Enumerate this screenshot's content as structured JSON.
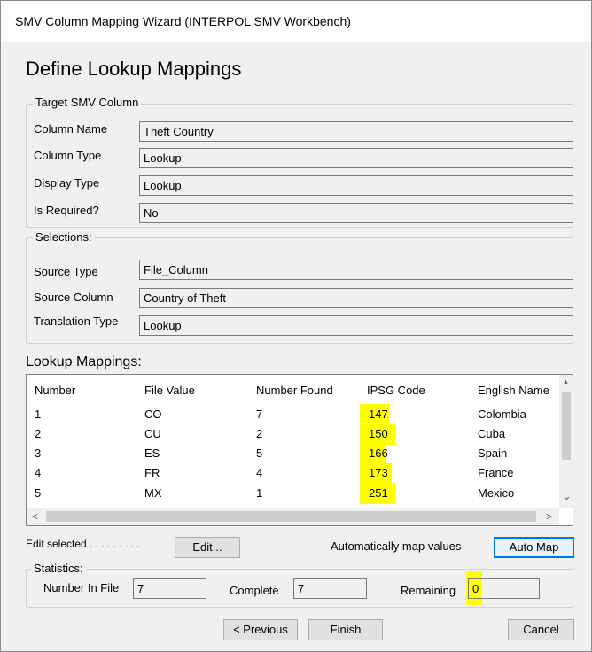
{
  "window": {
    "title": "SMV Column Mapping Wizard (INTERPOL SMV Workbench)"
  },
  "page_title": "Define Lookup Mappings",
  "target": {
    "group_label": "Target SMV Column",
    "column_name_label": "Column Name",
    "column_name": "Theft Country",
    "column_type_label": "Column Type",
    "column_type": "Lookup",
    "display_type_label": "Display Type",
    "display_type": "Lookup",
    "is_required_label": "Is Required?",
    "is_required": "No"
  },
  "selections": {
    "group_label": "Selections:",
    "source_type_label": "Source Type",
    "source_type": "File_Column",
    "source_column_label": "Source Column",
    "source_column": "Country of Theft",
    "translation_type_label": "Translation Type",
    "translation_type": "Lookup"
  },
  "mappings": {
    "title": "Lookup Mappings:",
    "columns": [
      "Number",
      "File Value",
      "Number Found",
      "IPSG Code",
      "English Name"
    ],
    "rows": [
      [
        "1",
        "CO",
        "7",
        "147",
        "Colombia"
      ],
      [
        "2",
        "CU",
        "2",
        "150",
        "Cuba"
      ],
      [
        "3",
        "ES",
        "5",
        "166",
        "Spain"
      ],
      [
        "4",
        "FR",
        "4",
        "173",
        "France"
      ],
      [
        "5",
        "MX",
        "1",
        "251",
        "Mexico"
      ]
    ],
    "highlight_color": "#ffff00"
  },
  "actions": {
    "edit_selected_label": "Edit selected . . . . . . . . .",
    "edit_button": "Edit...",
    "auto_map_label": "Automatically map values",
    "auto_map_button": "Auto Map"
  },
  "statistics": {
    "group_label": "Statistics:",
    "in_file_label": "Number In File",
    "in_file": "7",
    "complete_label": "Complete",
    "complete": "7",
    "remaining_label": "Remaining",
    "remaining": "0"
  },
  "nav": {
    "previous": "< Previous",
    "finish": "Finish",
    "cancel": "Cancel"
  },
  "icons": {
    "scroll_up": "▲",
    "scroll_down": "⌄",
    "scroll_left": "<",
    "scroll_right": ">"
  },
  "accent": "#0078d7"
}
